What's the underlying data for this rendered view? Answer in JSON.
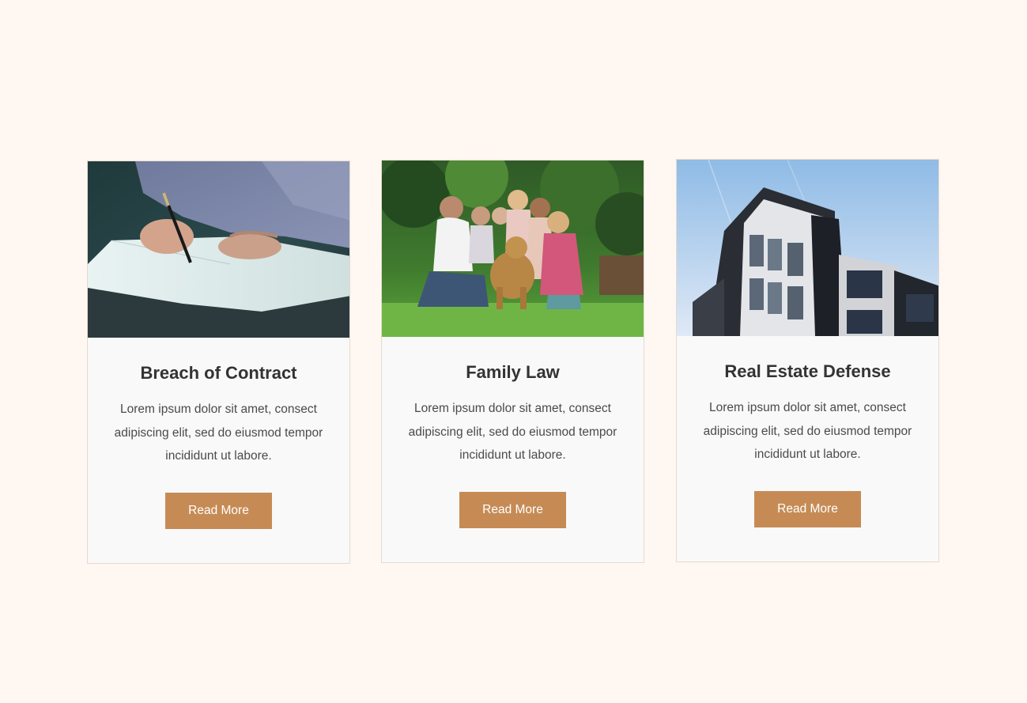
{
  "cards": [
    {
      "title": "Breach of Contract",
      "text": "Lorem ipsum dolor sit amet, consect adipiscing elit, sed do eiusmod tempor incididunt ut labore.",
      "button_label": "Read More",
      "image": "person-signing-contract-photo"
    },
    {
      "title": "Family Law",
      "text": "Lorem ipsum dolor sit amet, consect adipiscing elit, sed do eiusmod tempor incididunt ut labore.",
      "button_label": "Read More",
      "image": "family-with-dog-photo"
    },
    {
      "title": "Real Estate Defense",
      "text": "Lorem ipsum dolor sit amet, consect adipiscing elit, sed do eiusmod tempor incididunt ut labore.",
      "button_label": "Read More",
      "image": "modern-building-photo"
    }
  ],
  "colors": {
    "page_background": "#fff7f1",
    "card_background": "#f9f9fa",
    "button_background": "#c68b55",
    "title_color": "#333333",
    "text_color": "#4a4a4a"
  }
}
